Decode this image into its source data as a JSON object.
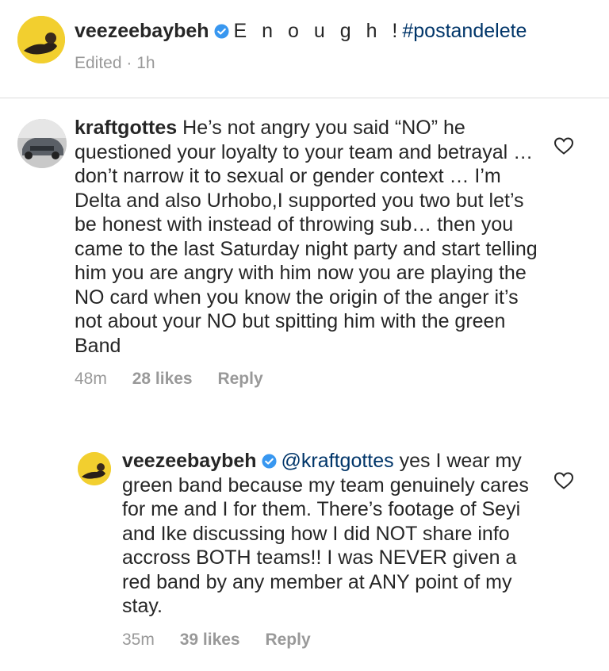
{
  "caption": {
    "username": "veezeebaybeh",
    "text": "E n o u g h !",
    "hashtag": "#postandelete",
    "meta": "Edited · 1h"
  },
  "comments": [
    {
      "username": "kraftgottes",
      "text": "He’s not angry you said “NO” he questioned your loyalty to your team and betrayal … don’t narrow it to sexual or gender context … I’m Delta and also Urhobo,I supported you two but let’s be honest with instead of throwing sub… then you came to the last Saturday night party and start telling him you are angry with him now you are playing the NO card when you know the origin of the anger it’s not about your NO but spitting him with the green Band",
      "time": "48m",
      "likes": "28 likes",
      "reply": "Reply"
    },
    {
      "username": "veezeebaybeh",
      "mention": "@kraftgottes",
      "text": "yes I wear my green band because my team genuinely cares for me and I for them. There’s footage of Seyi and Ike discussing how I did NOT share info accross BOTH teams!! I was NEVER given a red band by any member at ANY point of my stay.",
      "time": "35m",
      "likes": "39 likes",
      "reply": "Reply"
    }
  ],
  "icons": {
    "verified": "verified-badge-icon",
    "heart": "heart-outline-icon"
  },
  "colors": {
    "link": "#003569",
    "verified": "#3897f0",
    "muted": "#999999"
  }
}
